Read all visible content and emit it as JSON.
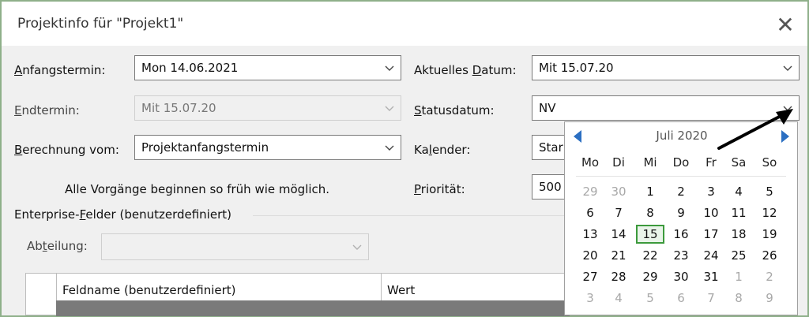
{
  "window": {
    "title": "Projektinfo für \"Projekt1\"",
    "close_glyph": "✕"
  },
  "fields": {
    "start": {
      "label_pre": "",
      "label_u": "A",
      "label_post": "nfangstermin:",
      "value": "Mon 14.06.2021"
    },
    "end": {
      "label_pre": "",
      "label_u": "E",
      "label_post": "ndtermin:",
      "value": "Mit 15.07.20"
    },
    "schedule_from": {
      "label_pre": "",
      "label_u": "B",
      "label_post": "erechnung vom:",
      "value": "Projektanfangstermin"
    },
    "current_date": {
      "label_pre": "Aktuelles ",
      "label_u": "D",
      "label_post": "atum:",
      "value": "Mit 15.07.20"
    },
    "status_date": {
      "label_pre": "",
      "label_u": "S",
      "label_post": "tatusdatum:",
      "value": "NV"
    },
    "calendar": {
      "label_pre": "Ka",
      "label_u": "l",
      "label_post": "ender:",
      "value": "Star"
    },
    "priority": {
      "label_pre": "",
      "label_u": "P",
      "label_post": "riorität:",
      "value": "500"
    }
  },
  "note": "Alle Vorgänge beginnen so früh wie möglich.",
  "enterprise": {
    "group_pre": "Enterprise-",
    "group_u": "F",
    "group_post": "elder (benutzerdefiniert)",
    "dept_pre": "Ab",
    "dept_u": "t",
    "dept_post": "eilung:",
    "columns": [
      "Feldname (benutzerdefiniert)",
      "Wert"
    ]
  },
  "calendar_popup": {
    "month": "Juli 2020",
    "weekdays": [
      "Mo",
      "Di",
      "Mi",
      "Do",
      "Fr",
      "Sa",
      "So"
    ],
    "weeks": [
      [
        [
          "29",
          true
        ],
        [
          "30",
          true
        ],
        [
          "1",
          false
        ],
        [
          "2",
          false
        ],
        [
          "3",
          false
        ],
        [
          "4",
          false
        ],
        [
          "5",
          false
        ]
      ],
      [
        [
          "6",
          false
        ],
        [
          "7",
          false
        ],
        [
          "8",
          false
        ],
        [
          "9",
          false
        ],
        [
          "10",
          false
        ],
        [
          "11",
          false
        ],
        [
          "12",
          false
        ]
      ],
      [
        [
          "13",
          false
        ],
        [
          "14",
          false
        ],
        [
          "15",
          false
        ],
        [
          "16",
          false
        ],
        [
          "17",
          false
        ],
        [
          "18",
          false
        ],
        [
          "19",
          false
        ]
      ],
      [
        [
          "20",
          false
        ],
        [
          "21",
          false
        ],
        [
          "22",
          false
        ],
        [
          "23",
          false
        ],
        [
          "24",
          false
        ],
        [
          "25",
          false
        ],
        [
          "26",
          false
        ]
      ],
      [
        [
          "27",
          false
        ],
        [
          "28",
          false
        ],
        [
          "29",
          false
        ],
        [
          "30",
          false
        ],
        [
          "31",
          false
        ],
        [
          "1",
          true
        ],
        [
          "2",
          true
        ]
      ],
      [
        [
          "3",
          true
        ],
        [
          "4",
          true
        ],
        [
          "5",
          true
        ],
        [
          "6",
          true
        ],
        [
          "7",
          true
        ],
        [
          "8",
          true
        ],
        [
          "9",
          true
        ]
      ]
    ],
    "today": "15",
    "today_color": "#3c9a3c",
    "nav_color": "#2b6fc2"
  }
}
